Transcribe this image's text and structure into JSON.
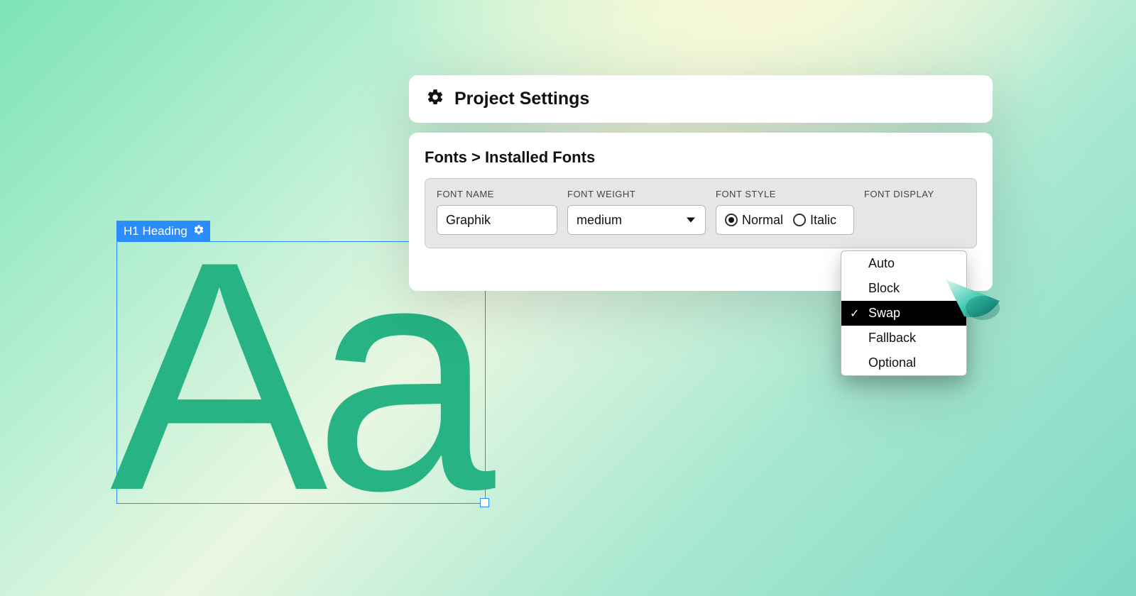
{
  "element": {
    "tag_label": "H1 Heading",
    "sample": "Aa"
  },
  "panel": {
    "title": "Project Settings",
    "breadcrumb": "Fonts > Installed Fonts",
    "fields": {
      "font_name": {
        "label": "FONT NAME",
        "value": "Graphik"
      },
      "font_weight": {
        "label": "FONT WEIGHT",
        "value": "medium"
      },
      "font_style": {
        "label": "FONT STYLE",
        "options": [
          {
            "label": "Normal",
            "checked": true
          },
          {
            "label": "Italic",
            "checked": false
          }
        ]
      },
      "font_display": {
        "label": "FONT DISPLAY",
        "selected": "Swap",
        "options": [
          "Auto",
          "Block",
          "Swap",
          "Fallback",
          "Optional"
        ]
      }
    }
  }
}
